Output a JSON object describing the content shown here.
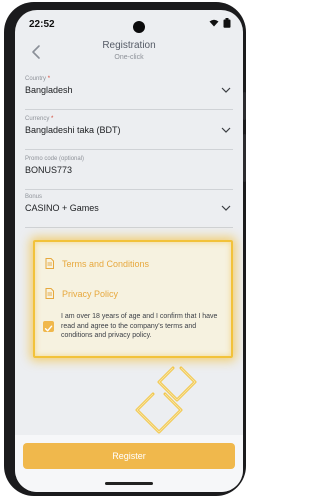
{
  "status": {
    "time": "22:52"
  },
  "header": {
    "title": "Registration",
    "subtitle": "One-click"
  },
  "form": {
    "country": {
      "label": "Country",
      "required_mark": "*",
      "value": "Bangladesh"
    },
    "currency": {
      "label": "Currency",
      "required_mark": "*",
      "value": "Bangladeshi taka (BDT)"
    },
    "promo": {
      "label": "Promo code (optional)",
      "value": "BONUS773"
    },
    "bonus": {
      "label": "Bonus",
      "value": "CASINO + Games"
    }
  },
  "consent": {
    "terms_link": "Terms and Conditions",
    "privacy_link": "Privacy Policy",
    "agreement_text": "I am over 18 years of age and I confirm that I have read and agree to the company's terms and conditions and privacy policy.",
    "checked": true
  },
  "actions": {
    "register_label": "Register"
  },
  "colors": {
    "accent": "#f0b84c",
    "link": "#e7a83d",
    "highlight": "#f2c23a"
  },
  "icons": [
    "back-arrow-icon",
    "wifi-icon",
    "battery-icon",
    "camera-cutout",
    "chevron-down-icon",
    "document-icon",
    "checkmark-icon",
    "double-chevron-arrow-icon"
  ]
}
